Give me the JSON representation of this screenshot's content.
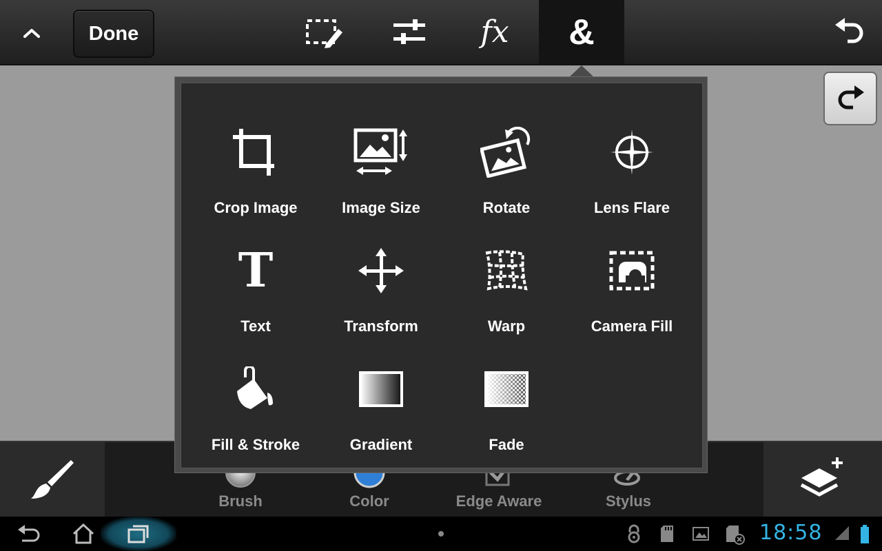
{
  "toolbar": {
    "done_label": "Done",
    "tools": [
      {
        "icon": "selection-pencil-icon"
      },
      {
        "icon": "sliders-icon"
      },
      {
        "icon": "fx-icon",
        "glyph": "fx"
      },
      {
        "icon": "ampersand-icon",
        "glyph": "&",
        "active": true
      }
    ],
    "undo_icon": "undo-icon",
    "redo_icon": "redo-icon"
  },
  "popup": {
    "items": [
      {
        "label": "Crop Image",
        "icon": "crop-icon"
      },
      {
        "label": "Image Size",
        "icon": "image-size-icon"
      },
      {
        "label": "Rotate",
        "icon": "rotate-image-icon"
      },
      {
        "label": "Lens Flare",
        "icon": "lens-flare-icon"
      },
      {
        "label": "Text",
        "icon": "text-icon",
        "glyph": "T"
      },
      {
        "label": "Transform",
        "icon": "move-arrows-icon"
      },
      {
        "label": "Warp",
        "icon": "warp-grid-icon"
      },
      {
        "label": "Camera Fill",
        "icon": "camera-fill-icon"
      },
      {
        "label": "Fill & Stroke",
        "icon": "paint-bucket-icon"
      },
      {
        "label": "Gradient",
        "icon": "gradient-icon"
      },
      {
        "label": "Fade",
        "icon": "fade-icon"
      }
    ]
  },
  "bottom": {
    "options": [
      {
        "label": "Brush",
        "icon": "brush-sphere-icon"
      },
      {
        "label": "Color",
        "icon": "color-swatch-icon",
        "color": "#2f7fd6"
      },
      {
        "label": "Edge Aware",
        "icon": "checkbox-icon"
      },
      {
        "label": "Stylus",
        "icon": "stylus-icon"
      }
    ],
    "brush_tool_icon": "paintbrush-icon",
    "layers_icon": "add-layer-icon"
  },
  "system": {
    "clock": "18:58",
    "clock_color": "#34b5e5"
  }
}
